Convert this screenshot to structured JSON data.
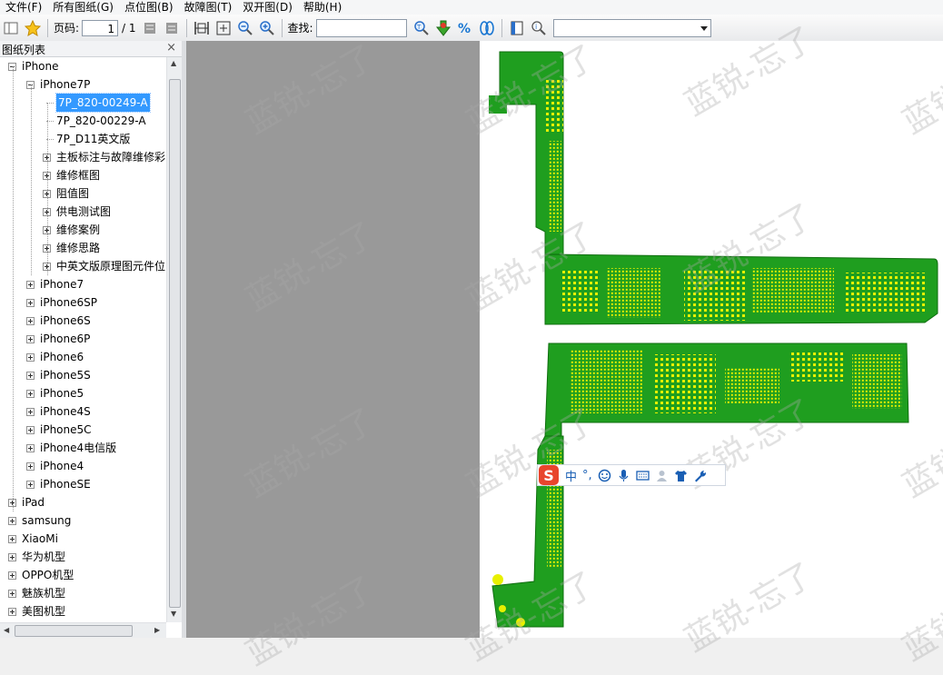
{
  "menu": [
    "文件(F)",
    "所有图纸(G)",
    "点位图(B)",
    "故障图(T)",
    "双开图(D)",
    "帮助(H)"
  ],
  "toolbar": {
    "page_label": "页码:",
    "page_value": "1",
    "page_total": "/ 1",
    "find_label": "查找:",
    "find_value": "",
    "combo_value": ""
  },
  "panel": {
    "title": "图纸列表",
    "close": "×"
  },
  "tree": [
    {
      "label": "iPhone",
      "level": 0,
      "expander": "minus"
    },
    {
      "label": "iPhone7P",
      "level": 1,
      "expander": "minus"
    },
    {
      "label": "7P_820-00249-A",
      "level": 2,
      "expander": "none",
      "selected": true
    },
    {
      "label": "7P_820-00229-A",
      "level": 2,
      "expander": "none"
    },
    {
      "label": "7P_D11英文版",
      "level": 2,
      "expander": "none"
    },
    {
      "label": "主板标注与故障维修彩",
      "level": 2,
      "expander": "plus"
    },
    {
      "label": "维修框图",
      "level": 2,
      "expander": "plus"
    },
    {
      "label": "阻值图",
      "level": 2,
      "expander": "plus"
    },
    {
      "label": "供电测试图",
      "level": 2,
      "expander": "plus"
    },
    {
      "label": "维修案例",
      "level": 2,
      "expander": "plus"
    },
    {
      "label": "维修思路",
      "level": 2,
      "expander": "plus"
    },
    {
      "label": "中英文版原理图元件位",
      "level": 2,
      "expander": "plus"
    },
    {
      "label": "iPhone7",
      "level": 1,
      "expander": "plus"
    },
    {
      "label": "iPhone6SP",
      "level": 1,
      "expander": "plus"
    },
    {
      "label": "iPhone6S",
      "level": 1,
      "expander": "plus"
    },
    {
      "label": "iPhone6P",
      "level": 1,
      "expander": "plus"
    },
    {
      "label": "iPhone6",
      "level": 1,
      "expander": "plus"
    },
    {
      "label": "iPhone5S",
      "level": 1,
      "expander": "plus"
    },
    {
      "label": "iPhone5",
      "level": 1,
      "expander": "plus"
    },
    {
      "label": "iPhone4S",
      "level": 1,
      "expander": "plus"
    },
    {
      "label": "iPhone5C",
      "level": 1,
      "expander": "plus"
    },
    {
      "label": "iPhone4电信版",
      "level": 1,
      "expander": "plus"
    },
    {
      "label": "iPhone4",
      "level": 1,
      "expander": "plus"
    },
    {
      "label": "iPhoneSE",
      "level": 1,
      "expander": "plus"
    },
    {
      "label": "iPad",
      "level": 0,
      "expander": "plus"
    },
    {
      "label": "samsung",
      "level": 0,
      "expander": "plus"
    },
    {
      "label": "XiaoMi",
      "level": 0,
      "expander": "plus"
    },
    {
      "label": "华为机型",
      "level": 0,
      "expander": "plus"
    },
    {
      "label": "OPPO机型",
      "level": 0,
      "expander": "plus"
    },
    {
      "label": "魅族机型",
      "level": 0,
      "expander": "plus"
    },
    {
      "label": "美图机型",
      "level": 0,
      "expander": "plus"
    }
  ],
  "watermark": "蓝锐-忘了",
  "ime": {
    "logo": "S",
    "mode": "中",
    "punct": "°,"
  },
  "colors": {
    "pcb_green": "#1f9e1f",
    "pcb_yellow": "#e8f000",
    "selection": "#3399ff",
    "viewer_gray": "#999999"
  }
}
